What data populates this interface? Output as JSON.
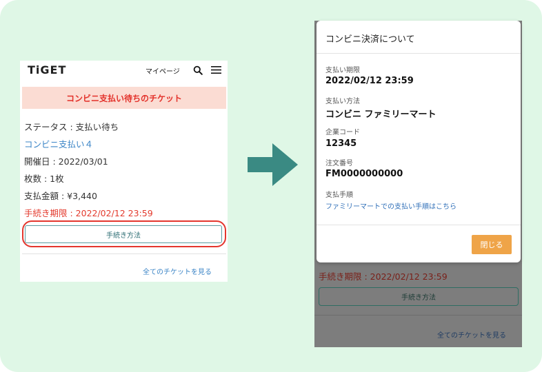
{
  "left": {
    "logo": "TiGET",
    "mypage": "マイページ",
    "banner": "コンビニ支払い待ちのチケット",
    "status": "ステータス : 支払い待ち",
    "payment_link": "コンビニ支払い４",
    "date": "開催日 : 2022/03/01",
    "count": "枚数 : 1枚",
    "amount": "支払金額 : ¥3,440",
    "deadline": "手続き期限 : 2022/02/12 23:59",
    "procedure_button": "手続き方法",
    "all_tickets": "全てのチケットを見る"
  },
  "right_bg": {
    "deadline": "手続き期限 : 2022/02/12 23:59",
    "procedure_button": "手続き方法",
    "all_tickets": "全てのチケットを見る"
  },
  "modal": {
    "title": "コンビニ決済について",
    "fields": [
      {
        "label": "支払い期限",
        "value": "2022/02/12 23:59"
      },
      {
        "label": "支払い方法",
        "value": "コンビニ ファミリーマート"
      },
      {
        "label": "企業コード",
        "value": "12345"
      },
      {
        "label": "注文番号",
        "value": "FM0000000000"
      }
    ],
    "procedure_label": "支払手順",
    "procedure_link": "ファミリーマートでの支払い手順はこちら",
    "close_button": "閉じる"
  },
  "colors": {
    "background": "#dff7e6",
    "banner_bg": "#fbdcd3",
    "alert_red": "#e3312a",
    "link_blue": "#3a84c6",
    "arrow_teal": "#3a8a83",
    "close_orange": "#efa448"
  },
  "icons": {
    "search": "search-icon",
    "menu": "hamburger-menu-icon",
    "arrow": "right-arrow-icon"
  }
}
